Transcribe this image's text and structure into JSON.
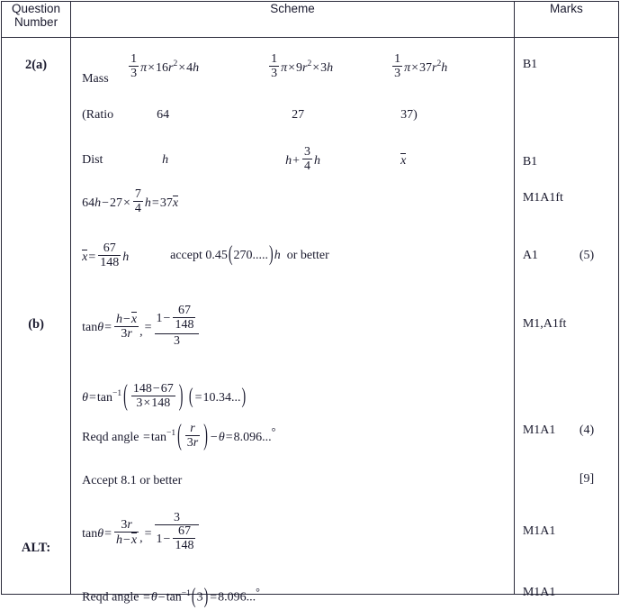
{
  "document": {
    "type": "mark-scheme-table",
    "headers": {
      "question_number": "Question\nNumber",
      "question_number_line1": "Question",
      "question_number_line2": "Number",
      "scheme": "Scheme",
      "marks": "Marks"
    }
  },
  "question_numbers": {
    "part_a": "2(a)",
    "part_b": "(b)",
    "alt": "ALT:"
  },
  "scheme": {
    "mass_label": "Mass",
    "mass_expr_1": "1/3 π × 16r² × 4h",
    "mass_expr_2": "1/3 π × 9r² × 3h",
    "mass_expr_3": "1/3 π × 37r²h",
    "ratio_label": "(Ratio",
    "ratio_1": "64",
    "ratio_2": "27",
    "ratio_3": "37)",
    "dist_label": "Dist",
    "dist_1": "h",
    "dist_2": "h + 3/4 h",
    "dist_3": "x̄",
    "moments_equation": "64h − 27 × 7/4 h = 37x̄",
    "xbar_result": "x̄ = 67/148 h",
    "accept_note": "accept 0.45(270.....)h  or better",
    "tan_theta_b": "tan θ = (h − x̄)/(3r), = (1 − 67/148)/3",
    "theta_arctan": "θ = tan⁻¹((148 − 67)/(3×148))  (=10.34...)",
    "reqd_angle_b": "Reqd angle = tan⁻¹(r/3r) − θ = 8.096...°",
    "accept_tolerance": "Accept 8.1 or better",
    "tan_theta_alt": "tan θ = 3r/(h − x̄), = 3/(1 − 67/148)",
    "reqd_angle_alt": "Reqd angle = θ − tan⁻¹(3) = 8.096...°",
    "numbers": {
      "third_num": "1",
      "third_den": "3",
      "sixteen": "16",
      "four_h": "4",
      "nine": "9",
      "three_h": "3",
      "thirtyseven": "37",
      "three_quarter_num": "3",
      "three_quarter_den": "4",
      "seven_num": "7",
      "four_den": "4",
      "sixtyfour_h": "64",
      "twentyseven": "27",
      "thirtyseven_x": "37",
      "sixtyseven": "67",
      "onefortyeight": "148",
      "one": "1",
      "three": "3",
      "three_r": "3",
      "value_1034": "10.34...",
      "value_8096": "8.096...",
      "value_81": "8.1",
      "value_045": "0.45",
      "value_270": "270.....",
      "arctan_arg_alt": "3"
    }
  },
  "marks": {
    "b1_mass": "B1",
    "b1_dist": "B1",
    "m1a1ft_moments": "M1A1ft",
    "a1_xbar": "A1",
    "total_a": "(5)",
    "m1a1ft_tan": "M1,A1ft",
    "m1a1_reqd": "M1A1",
    "total_b": "(4)",
    "total_question": "[9]",
    "m1a1_alt_tan": "M1A1",
    "m1a1_alt_reqd": "M1A1"
  },
  "colors": {
    "text": "#1a1a2e",
    "border": "#2a2a3a",
    "background": "#ffffff"
  }
}
